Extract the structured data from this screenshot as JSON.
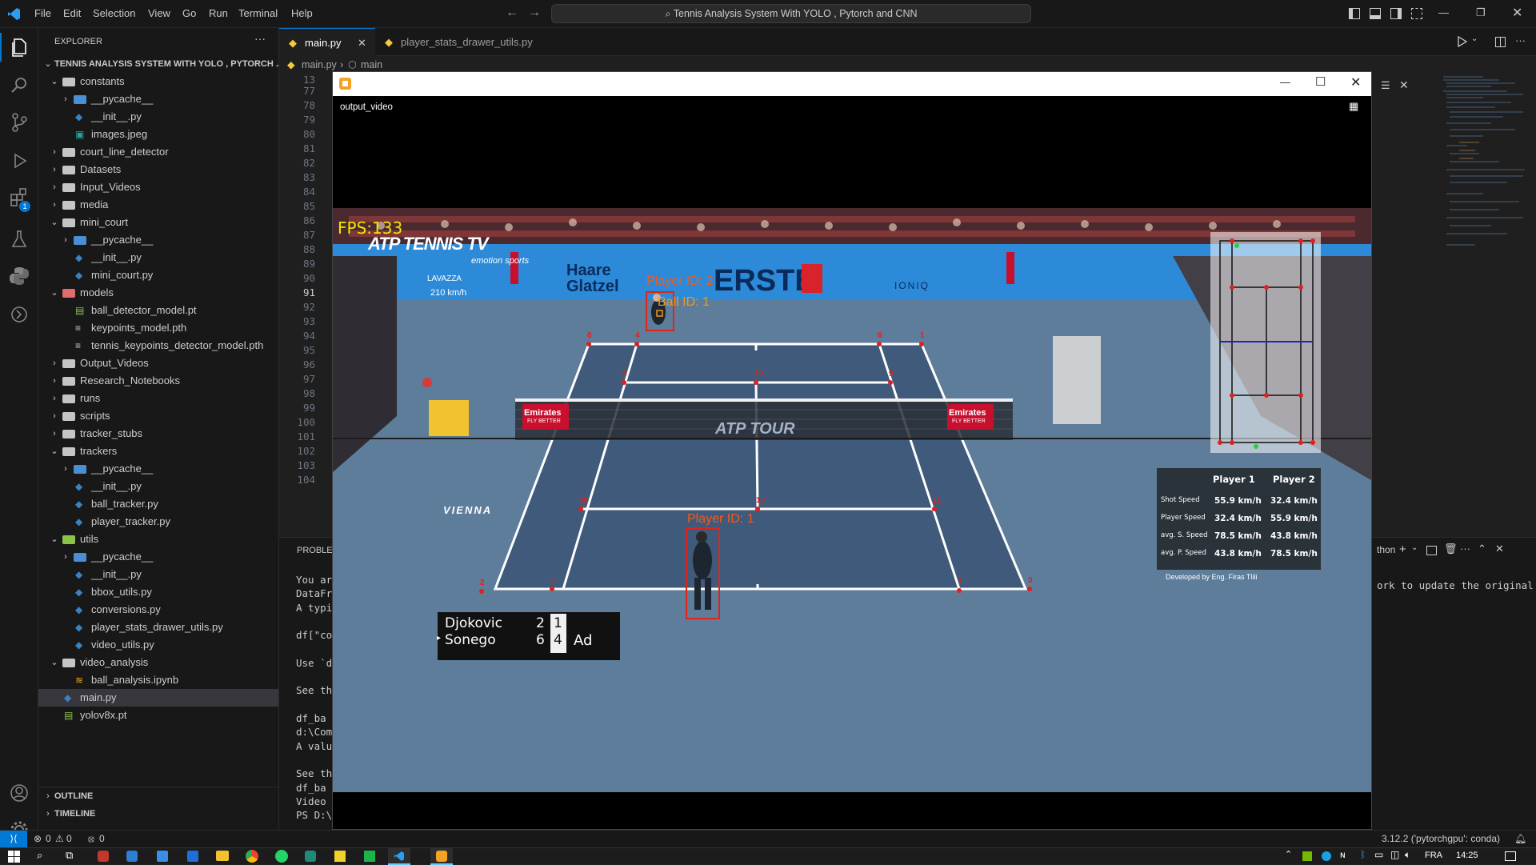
{
  "menu": [
    "File",
    "Edit",
    "Selection",
    "View",
    "Go",
    "Run",
    "Terminal",
    "Help"
  ],
  "search_text": "Tennis Analysis System With YOLO , Pytorch and CNN",
  "explorer": {
    "header": "EXPLORER",
    "project": "TENNIS ANALYSIS SYSTEM WITH YOLO , PYTORCH ...",
    "items": [
      {
        "label": "constants",
        "depth": 1,
        "type": "folder-open"
      },
      {
        "label": "__pycache__",
        "depth": 2,
        "type": "folder"
      },
      {
        "label": "__init__.py",
        "depth": 2,
        "type": "py"
      },
      {
        "label": "images.jpeg",
        "depth": 2,
        "type": "img"
      },
      {
        "label": "court_line_detector",
        "depth": 1,
        "type": "folder"
      },
      {
        "label": "Datasets",
        "depth": 1,
        "type": "folder"
      },
      {
        "label": "Input_Videos",
        "depth": 1,
        "type": "folder"
      },
      {
        "label": "media",
        "depth": 1,
        "type": "folder"
      },
      {
        "label": "mini_court",
        "depth": 1,
        "type": "folder-open"
      },
      {
        "label": "__pycache__",
        "depth": 2,
        "type": "folder"
      },
      {
        "label": "__init__.py",
        "depth": 2,
        "type": "py"
      },
      {
        "label": "mini_court.py",
        "depth": 2,
        "type": "py"
      },
      {
        "label": "models",
        "depth": 1,
        "type": "folder-open-red"
      },
      {
        "label": "ball_detector_model.pt",
        "depth": 2,
        "type": "pt"
      },
      {
        "label": "keypoints_model.pth",
        "depth": 2,
        "type": "file"
      },
      {
        "label": "tennis_keypoints_detector_model.pth",
        "depth": 2,
        "type": "file"
      },
      {
        "label": "Output_Videos",
        "depth": 1,
        "type": "folder"
      },
      {
        "label": "Research_Notebooks",
        "depth": 1,
        "type": "folder"
      },
      {
        "label": "runs",
        "depth": 1,
        "type": "folder"
      },
      {
        "label": "scripts",
        "depth": 1,
        "type": "folder"
      },
      {
        "label": "tracker_stubs",
        "depth": 1,
        "type": "folder"
      },
      {
        "label": "trackers",
        "depth": 1,
        "type": "folder-open"
      },
      {
        "label": "__pycache__",
        "depth": 2,
        "type": "folder"
      },
      {
        "label": "__init__.py",
        "depth": 2,
        "type": "py"
      },
      {
        "label": "ball_tracker.py",
        "depth": 2,
        "type": "py"
      },
      {
        "label": "player_tracker.py",
        "depth": 2,
        "type": "py"
      },
      {
        "label": "utils",
        "depth": 1,
        "type": "folder-open-green"
      },
      {
        "label": "__pycache__",
        "depth": 2,
        "type": "folder"
      },
      {
        "label": "__init__.py",
        "depth": 2,
        "type": "py"
      },
      {
        "label": "bbox_utils.py",
        "depth": 2,
        "type": "py"
      },
      {
        "label": "conversions.py",
        "depth": 2,
        "type": "py"
      },
      {
        "label": "player_stats_drawer_utils.py",
        "depth": 2,
        "type": "py"
      },
      {
        "label": "video_utils.py",
        "depth": 2,
        "type": "py"
      },
      {
        "label": "video_analysis",
        "depth": 1,
        "type": "folder-open"
      },
      {
        "label": "ball_analysis.ipynb",
        "depth": 2,
        "type": "nb"
      },
      {
        "label": "main.py",
        "depth": 1,
        "type": "py",
        "selected": true
      },
      {
        "label": "yolov8x.pt",
        "depth": 1,
        "type": "pt"
      }
    ],
    "outline": "OUTLINE",
    "timeline": "TIMELINE"
  },
  "tabs": [
    {
      "label": "main.py",
      "active": true
    },
    {
      "label": "player_stats_drawer_utils.py",
      "active": false
    }
  ],
  "breadcrumb": {
    "file": "main.py",
    "symbol": "main"
  },
  "line_numbers": [
    "13",
    "77",
    "78",
    "79",
    "80",
    "81",
    "82",
    "83",
    "84",
    "85",
    "86",
    "87",
    "88",
    "89",
    "90",
    "91",
    "92",
    "93",
    "94",
    "95",
    "96",
    "97",
    "98",
    "99",
    "100",
    "101",
    "102",
    "103",
    "104"
  ],
  "active_line": "91",
  "panel": {
    "tab": "PROBLEM",
    "lines": [
      "You ar",
      "  DataFr",
      "A typic",
      "",
      "df[\"co",
      "",
      "Use `d",
      "",
      "See the",
      "",
      "  df_ba",
      "d:\\Comp",
      "A valu",
      "",
      "See the",
      "  df_ba",
      "Video s",
      "PS D:\\"
    ],
    "right_label": "thon",
    "right_text": "ork to update the original"
  },
  "status": {
    "errors": "0",
    "warnings": "0",
    "ports": "0",
    "interpreter": "3.12.2 ('pytorchgpu': conda)"
  },
  "taskbar": {
    "lang": "FRA",
    "time": "14:25"
  },
  "video": {
    "window_title": "output_video",
    "fps": "FPS:133",
    "broadcaster": "ATP TENNIS TV",
    "player2_label": "Player ID: 2",
    "ball_label": "Ball ID: 1",
    "player1_label": "Player ID: 1",
    "keypoints": [
      "0",
      "4",
      "6",
      "1",
      "8",
      "12",
      "9",
      "10",
      "13",
      "11",
      "2",
      "5",
      "7",
      "3"
    ],
    "sponsors": {
      "haare": "Haare Glatzel",
      "erste": "ERSTE",
      "ioniq": "IONIQ",
      "emirates": "Emirates",
      "emirates_sub": "FLY BETTER",
      "atptour": "ATP TOUR",
      "vienna": "VIENNA",
      "emotion": "emotion sports",
      "lavazza": "LAVAZZA",
      "kmh": "210 km/h"
    },
    "score": {
      "p1_name": "Djokovic",
      "p1_sets": [
        "2",
        "1"
      ],
      "p2_name": "Sonego",
      "p2_sets": [
        "6",
        "4"
      ],
      "point": "Ad"
    },
    "stats": {
      "headers": [
        "Player 1",
        "Player 2"
      ],
      "rows": [
        {
          "label": "Shot Speed",
          "p1": "55.9 km/h",
          "p2": "32.4 km/h"
        },
        {
          "label": "Player Speed",
          "p1": "32.4 km/h",
          "p2": "55.9 km/h"
        },
        {
          "label": "avg. S. Speed",
          "p1": "78.5 km/h",
          "p2": "43.8 km/h"
        },
        {
          "label": "avg. P. Speed",
          "p1": "43.8 km/h",
          "p2": "78.5 km/h"
        }
      ],
      "credit": "Developed by Eng. Firas Tlili"
    }
  }
}
